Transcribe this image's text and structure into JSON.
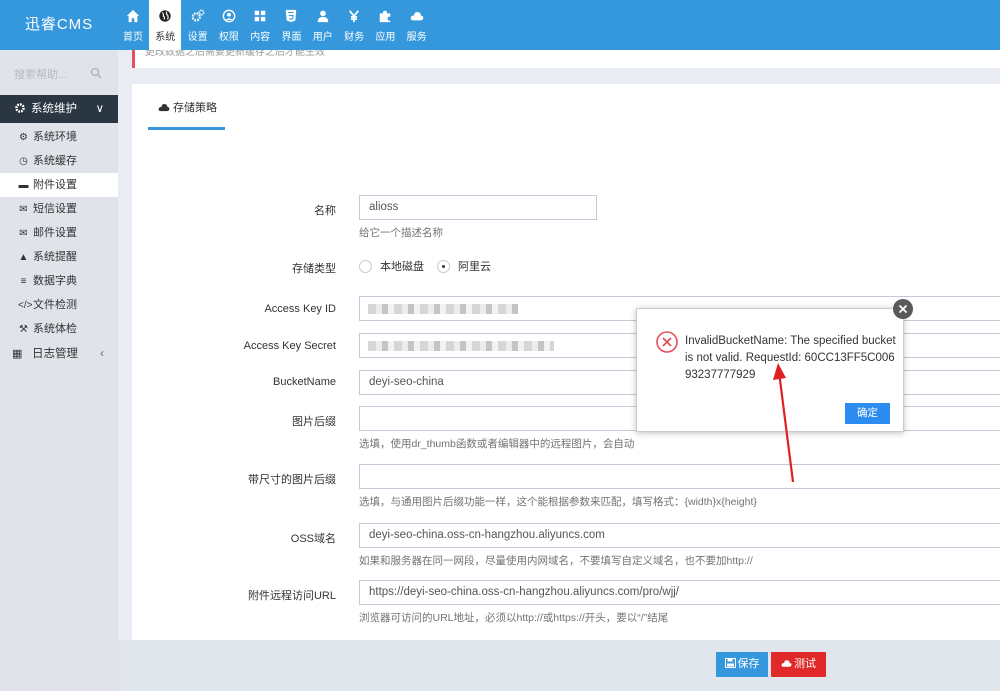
{
  "app": {
    "logo": "迅睿CMS"
  },
  "topnav": [
    {
      "label": "首页",
      "icon": "home-icon"
    },
    {
      "label": "系统",
      "icon": "globe-icon"
    },
    {
      "label": "设置",
      "icon": "cogs-icon"
    },
    {
      "label": "权限",
      "icon": "user-shield-icon"
    },
    {
      "label": "内容",
      "icon": "grid-icon"
    },
    {
      "label": "界面",
      "icon": "html5-icon"
    },
    {
      "label": "用户",
      "icon": "user-icon"
    },
    {
      "label": "财务",
      "icon": "yen-icon"
    },
    {
      "label": "应用",
      "icon": "puzzle-icon"
    },
    {
      "label": "服务",
      "icon": "cloud-icon"
    }
  ],
  "sidebar": {
    "search_placeholder": "搜索帮助...",
    "group": "系统维护",
    "items": [
      {
        "label": "系统环境",
        "icon": "cog-icon"
      },
      {
        "label": "系统缓存",
        "icon": "clock-icon"
      },
      {
        "label": "附件设置",
        "icon": "folder-icon"
      },
      {
        "label": "短信设置",
        "icon": "envelope-icon"
      },
      {
        "label": "邮件设置",
        "icon": "envelope-open-icon"
      },
      {
        "label": "系统提醒",
        "icon": "bell-icon"
      },
      {
        "label": "数据字典",
        "icon": "database-icon"
      },
      {
        "label": "文件检测",
        "icon": "code-icon"
      },
      {
        "label": "系统体检",
        "icon": "wrench-icon"
      }
    ],
    "log_group": "日志管理"
  },
  "notice": "更改数据之后需要更新缓存之后才能生效",
  "tab": {
    "label": "存储策略"
  },
  "form": {
    "name_label": "名称",
    "name_value": "alioss",
    "name_help": "给它一个描述名称",
    "type_label": "存储类型",
    "type_option_local": "本地磁盘",
    "type_option_aliyun": "阿里云",
    "access_key_id_label": "Access Key ID",
    "access_key_secret_label": "Access Key Secret",
    "bucket_label": "BucketName",
    "bucket_value": "deyi-seo-china",
    "img_suffix_label": "图片后缀",
    "img_suffix_help": "选填，使用dr_thumb函数或者编辑器中的远程图片，会自动",
    "size_suffix_label": "带尺寸的图片后缀",
    "size_suffix_help": "选填，与通用图片后缀功能一样，这个能根据参数来匹配，填写格式：{width}x{height}",
    "oss_domain_label": "OSS域名",
    "oss_domain_value": "deyi-seo-china.oss-cn-hangzhou.aliyuncs.com",
    "oss_domain_help": "如果和服务器在同一网段，尽量使用内网域名，不要填写自定义域名，也不要加http://",
    "remote_url_label": "附件远程访问URL",
    "remote_url_value": "https://deyi-seo-china.oss-cn-hangzhou.aliyuncs.com/pro/wjj/",
    "remote_url_help": "浏览器可访问的URL地址，必须以http://或https://开头，要以“/”结尾"
  },
  "buttons": {
    "save": "保存",
    "test": "测试"
  },
  "dialog": {
    "message": "InvalidBucketName: The specified bucket is not valid. RequestId: 60CC13FF5C00693237777929",
    "ok": "确定"
  },
  "colors": {
    "header": "#3598dc",
    "sidebar_active": "#2b3643",
    "save": "#3598dc",
    "test": "#e7505a",
    "ok": "#2d8cf0",
    "arrow": "#e02020"
  }
}
